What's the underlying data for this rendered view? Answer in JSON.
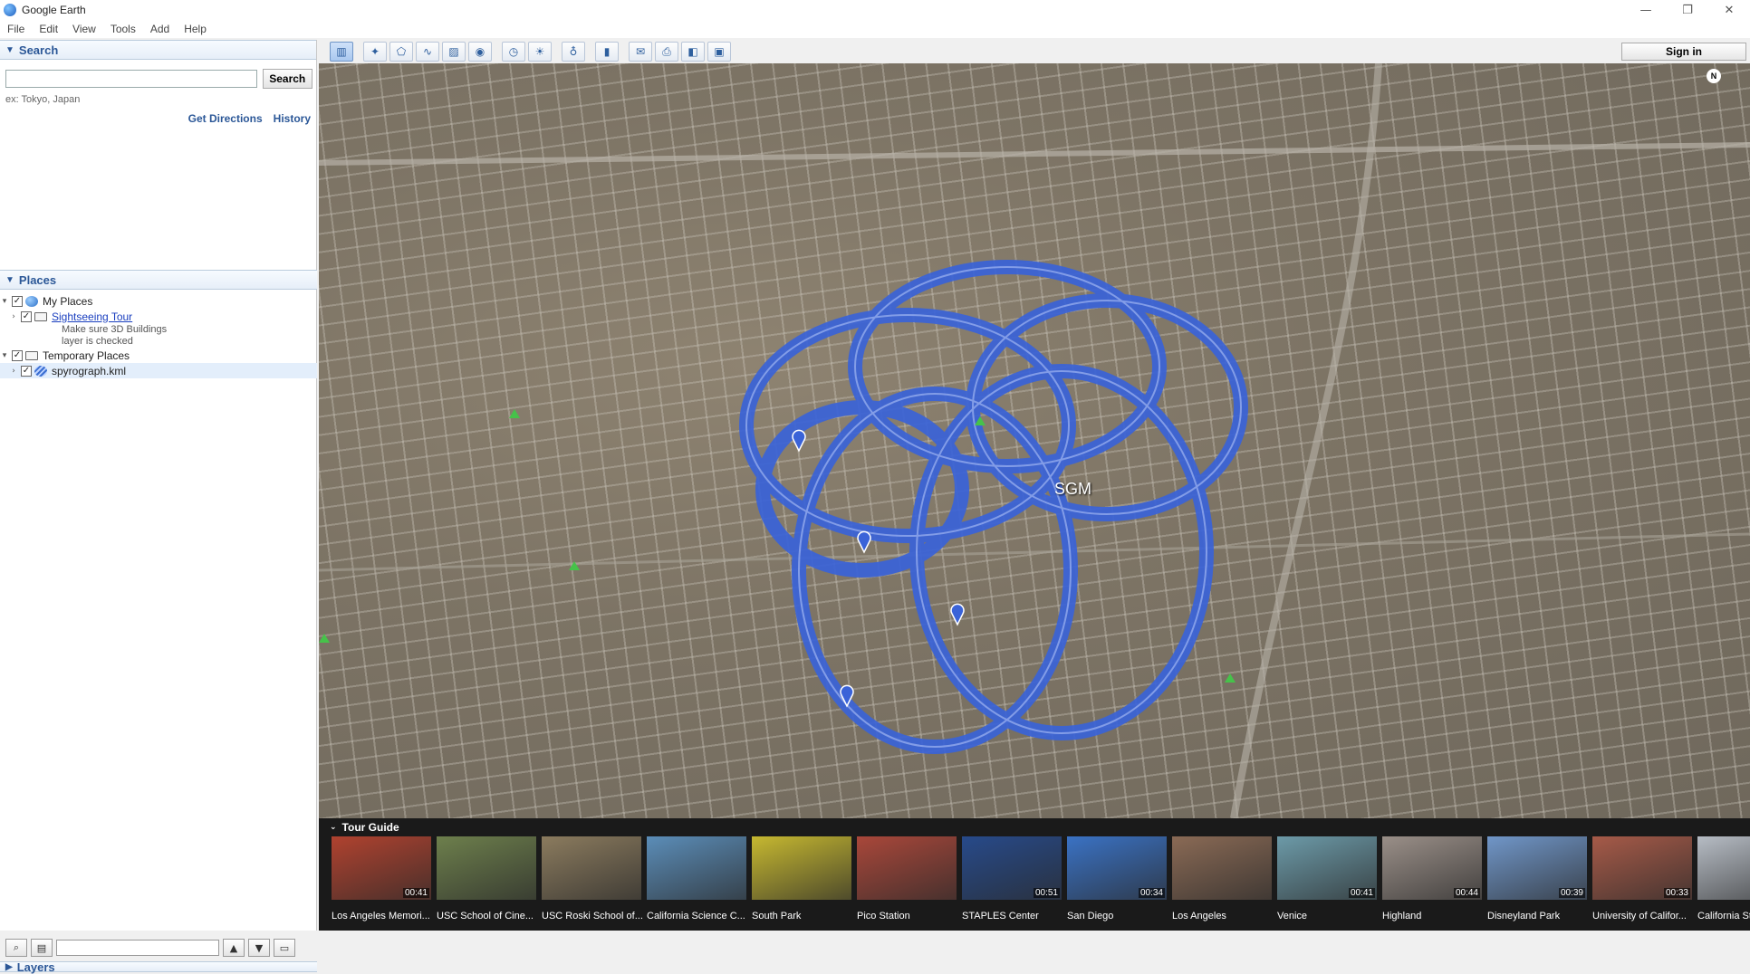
{
  "window": {
    "title": "Google Earth",
    "controls": [
      "—",
      "❐",
      "✕"
    ]
  },
  "menu": [
    "File",
    "Edit",
    "View",
    "Tools",
    "Add",
    "Help"
  ],
  "search": {
    "header": "Search",
    "button": "Search",
    "placeholder": "",
    "example": "ex: Tokyo, Japan",
    "links": {
      "directions": "Get Directions",
      "history": "History"
    }
  },
  "places": {
    "header": "Places",
    "items": [
      {
        "label": "My Places",
        "checked": true
      },
      {
        "label": "Sightseeing Tour",
        "checked": true,
        "desc": [
          "Make sure 3D Buildings",
          "layer is checked"
        ]
      },
      {
        "label": "Temporary Places",
        "checked": true
      },
      {
        "label": "spyrograph.kml",
        "checked": true,
        "selected": true
      }
    ]
  },
  "layers": {
    "header": "Layers"
  },
  "toolbar": {
    "signin": "Sign in"
  },
  "map": {
    "label": "SGM",
    "compass": "N"
  },
  "tour_guide": {
    "header": "Tour Guide",
    "items": [
      {
        "title": "Los Angeles Memori...",
        "duration": "00:41",
        "color": "#b0422f"
      },
      {
        "title": "USC School of Cine...",
        "duration": "",
        "color": "#6d7f4c"
      },
      {
        "title": "USC Roski School of...",
        "duration": "",
        "color": "#8b7b5e"
      },
      {
        "title": "California Science C...",
        "duration": "",
        "color": "#5b8db8"
      },
      {
        "title": "South Park",
        "duration": "",
        "color": "#c6b830"
      },
      {
        "title": "Pico Station",
        "duration": "",
        "color": "#a9473a"
      },
      {
        "title": "STAPLES Center",
        "duration": "00:51",
        "color": "#274a8a"
      },
      {
        "title": "San Diego",
        "duration": "00:34",
        "color": "#3a72c4"
      },
      {
        "title": "Los Angeles",
        "duration": "",
        "color": "#8a6a55"
      },
      {
        "title": "Venice",
        "duration": "00:41",
        "color": "#6c9aa8"
      },
      {
        "title": "Highland",
        "duration": "00:44",
        "color": "#9a8f88"
      },
      {
        "title": "Disneyland Park",
        "duration": "00:39",
        "color": "#7096c8"
      },
      {
        "title": "University of Califor...",
        "duration": "00:33",
        "color": "#a65a48"
      },
      {
        "title": "California Sta",
        "duration": "",
        "color": "#b6bcc4"
      }
    ]
  }
}
